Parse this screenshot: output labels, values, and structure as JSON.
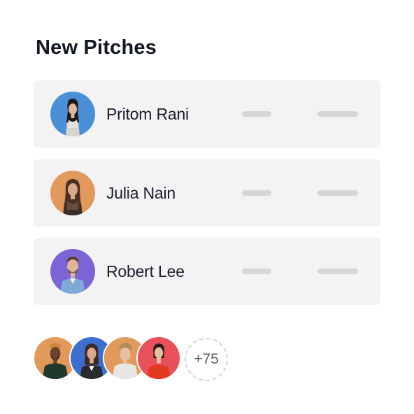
{
  "title": "New Pitches",
  "pitches": [
    {
      "name": "Pritom Rani",
      "avatar_bg": "#4a90d9",
      "avatar_icon": "woman-portrait-icon"
    },
    {
      "name": "Julia Nain",
      "avatar_bg": "#e29a5c",
      "avatar_icon": "woman-portrait-icon"
    },
    {
      "name": "Robert Lee",
      "avatar_bg": "#7b64d6",
      "avatar_icon": "man-portrait-icon"
    }
  ],
  "group_avatars": [
    {
      "bg": "#e29a5c",
      "icon": "man-portrait-icon"
    },
    {
      "bg": "#3d6fd1",
      "icon": "woman-portrait-icon"
    },
    {
      "bg": "#e29a5c",
      "icon": "man-portrait-icon"
    },
    {
      "bg": "#e8505b",
      "icon": "woman-portrait-icon"
    }
  ],
  "more_count": "+75"
}
